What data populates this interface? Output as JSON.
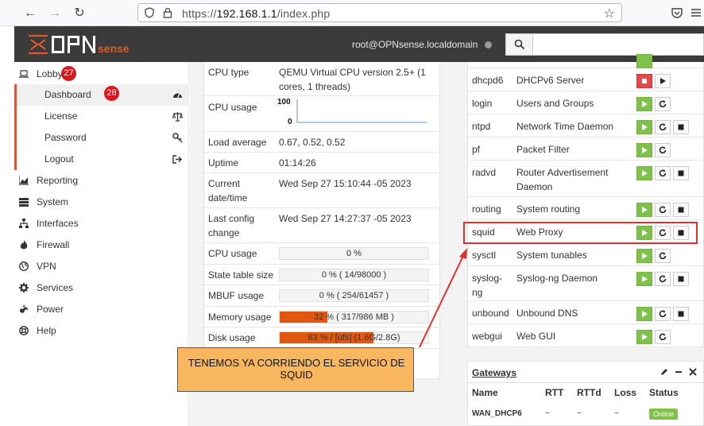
{
  "browser": {
    "url_prefix": "https://",
    "url_host": "192.168.1.1",
    "url_path": "/index.php"
  },
  "header": {
    "user": "root@OPNsense.localdomain"
  },
  "sidebar": {
    "lobby": {
      "label": "Lobby",
      "badge": "27"
    },
    "lobby_items": [
      {
        "label": "Dashboard",
        "badge": "28"
      },
      {
        "label": "License"
      },
      {
        "label": "Password"
      },
      {
        "label": "Logout"
      }
    ],
    "items": [
      {
        "label": "Reporting"
      },
      {
        "label": "System"
      },
      {
        "label": "Interfaces"
      },
      {
        "label": "Firewall"
      },
      {
        "label": "VPN"
      },
      {
        "label": "Services"
      },
      {
        "label": "Power"
      },
      {
        "label": "Help"
      }
    ]
  },
  "sysinfo": {
    "cpu_type_label": "CPU type",
    "cpu_type_value": "QEMU Virtual CPU version 2.5+ (1 cores, 1 threads)",
    "cpu_usage_label": "CPU usage",
    "cpu_graph_max": "100",
    "cpu_graph_min": "0",
    "load_label": "Load average",
    "load_value": "0.67, 0.52, 0.52",
    "uptime_label": "Uptime",
    "uptime_value": "01:14:26",
    "datetime_label": "Current date/time",
    "datetime_value": "Wed Sep 27 15:10:44 -05 2023",
    "lastconfig_label": "Last config change",
    "lastconfig_value": "Wed Sep 27 14:27:37 -05 2023",
    "cpu_usage2_label": "CPU usage",
    "cpu_usage2_value": "0 %",
    "cpu_usage2_level": 0,
    "state_label": "State table size",
    "state_value": "0 % ( 14/98000 )",
    "state_level": 0,
    "mbuf_label": "MBUF usage",
    "mbuf_value": "0 % ( 254/61457 )",
    "mbuf_level": 0,
    "memory_label": "Memory usage",
    "memory_value": "32 % ( 317/986 MB )",
    "memory_level": 32,
    "disk_label": "Disk usage",
    "disk_value": "63 % / [ufs] (1.6G/2.8G)",
    "disk_level": 63
  },
  "services": [
    {
      "name": "dhcpd6",
      "desc": "DHCPv6 Server",
      "state": "stopped"
    },
    {
      "name": "login",
      "desc": "Users and Groups",
      "state": "running"
    },
    {
      "name": "ntpd",
      "desc": "Network Time Daemon",
      "state": "running"
    },
    {
      "name": "pf",
      "desc": "Packet Filter",
      "state": "running"
    },
    {
      "name": "radvd",
      "desc": "Router Advertisement Daemon",
      "state": "running"
    },
    {
      "name": "routing",
      "desc": "System routing",
      "state": "running"
    },
    {
      "name": "squid",
      "desc": "Web Proxy",
      "state": "running"
    },
    {
      "name": "sysctl",
      "desc": "System tunables",
      "state": "running"
    },
    {
      "name": "syslog-ng",
      "desc": "Syslog-ng Daemon",
      "state": "running"
    },
    {
      "name": "unbound",
      "desc": "Unbound DNS",
      "state": "running"
    },
    {
      "name": "webgui",
      "desc": "Web GUI",
      "state": "running"
    }
  ],
  "gateways": {
    "title": "Gateways",
    "headers": [
      "Name",
      "RTT",
      "RTTd",
      "Loss",
      "Status"
    ],
    "rows": [
      {
        "name": "WAN_DHCP6",
        "rtt": "~",
        "rttd": "~",
        "loss": "~",
        "status": "Online"
      }
    ]
  },
  "annotation": {
    "text": "TENEMOS YA CORRIENDO EL SERVICIO DE SQUID"
  },
  "colors": {
    "accent": "#e0582a",
    "running": "#7fc24b",
    "stopped": "#e34b4b",
    "badge": "#d9171e",
    "callout": "#f8b75e"
  }
}
